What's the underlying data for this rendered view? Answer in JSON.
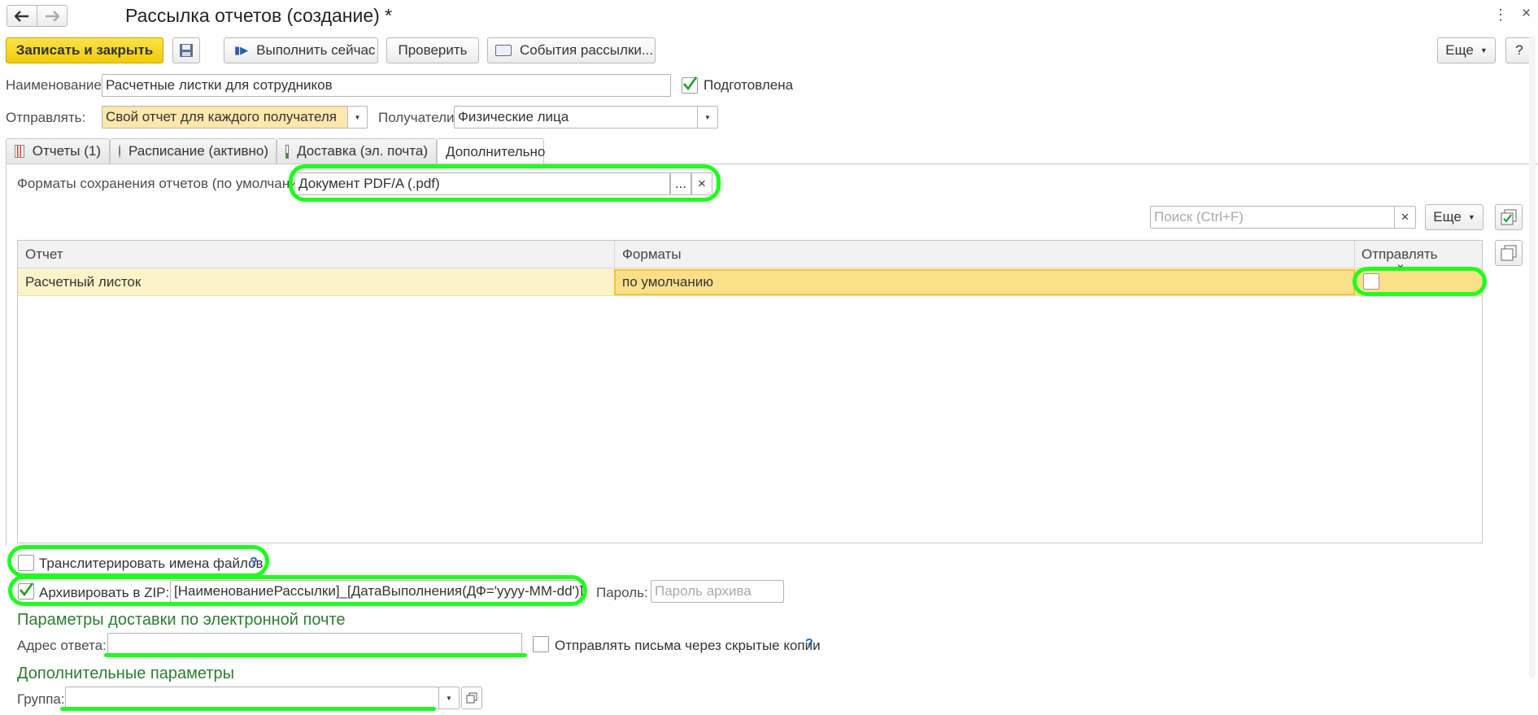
{
  "window": {
    "title": "Рассылка отчетов (создание) *"
  },
  "toolbar": {
    "save_close": "Записать и закрыть",
    "run_now": "Выполнить сейчас",
    "check": "Проверить",
    "events": "События рассылки...",
    "more": "Еще",
    "help": "?"
  },
  "form": {
    "name_label": "Наименование:",
    "name_value": "Расчетные листки для сотрудников",
    "prepared_label": "Подготовлена",
    "send_label": "Отправлять:",
    "send_value": "Свой отчет для каждого получателя",
    "recipients_label": "Получатели:",
    "recipients_value": "Физические лица"
  },
  "tabs": [
    {
      "label": "Отчеты (1)"
    },
    {
      "label": "Расписание (активно)"
    },
    {
      "label": "Доставка (эл. почта)"
    },
    {
      "label": "Дополнительно"
    }
  ],
  "reports": {
    "formats_label": "Форматы сохранения отчетов (по умолчанию):",
    "formats_value": "Документ PDF/A (.pdf)",
    "formats_pick": "...",
    "formats_clear": "×",
    "search_placeholder": "Поиск (Ctrl+F)",
    "search_clear": "×",
    "more": "Еще",
    "columns": [
      "Отчет",
      "Форматы",
      "Отправлять пустой"
    ],
    "rows": [
      {
        "report": "Расчетный листок",
        "formats": "по умолчанию",
        "send_empty": false
      }
    ]
  },
  "transliterate_label": "Транслитерировать имена файлов",
  "help_mark": "?",
  "archive": {
    "label": "Архивировать в ZIP:",
    "checked": true,
    "template": "[НаименованиеРассылки]_[ДатаВыполнения(ДФ='yyyy-MM-dd')]",
    "password_label": "Пароль:",
    "password_placeholder": "Пароль архива"
  },
  "email_section": {
    "title": "Параметры доставки по электронной почте",
    "reply_label": "Адрес ответа:",
    "reply_value": "",
    "bcc_label": "Отправлять письма через скрытые копии"
  },
  "extra_section": {
    "title": "Дополнительные параметры",
    "group_label": "Группа:",
    "group_value": ""
  },
  "colors": {
    "accent_yellow": "#f5d50f",
    "highlight": "#1fff1f",
    "selected_row": "#fdf3c9",
    "section_green": "#2e7d32"
  }
}
